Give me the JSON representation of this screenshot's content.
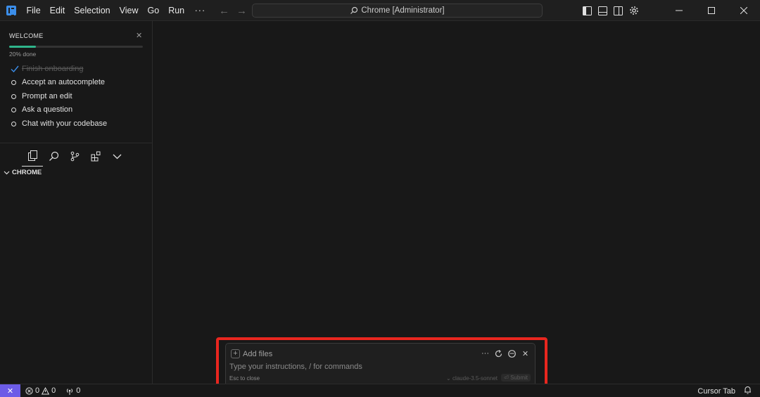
{
  "menu": [
    "File",
    "Edit",
    "Selection",
    "View",
    "Go",
    "Run"
  ],
  "menu_more": "···",
  "command_center": {
    "label": "Chrome [Administrator]"
  },
  "welcome": {
    "title": "WELCOME",
    "progress_text": "20% done",
    "progress_fraction": 0.2,
    "tasks": [
      {
        "label": "Finish onboarding",
        "done": true
      },
      {
        "label": "Accept an autocomplete",
        "done": false
      },
      {
        "label": "Prompt an edit",
        "done": false
      },
      {
        "label": "Ask a question",
        "done": false
      },
      {
        "label": "Chat with your codebase",
        "done": false
      }
    ]
  },
  "explorer": {
    "folder": "CHROME"
  },
  "prompt": {
    "add_files": "Add files",
    "placeholder": "Type your instructions, / for commands",
    "esc_hint": "Esc to close",
    "model": "claude-3.5-sonnet",
    "submit": "Submit"
  },
  "statusbar": {
    "errors": "0",
    "warnings": "0",
    "ports": "0",
    "cursor_tab": "Cursor Tab"
  },
  "colors": {
    "accent": "#6c5ce7",
    "progress": "#2fb58b",
    "highlight": "#e8261f"
  }
}
